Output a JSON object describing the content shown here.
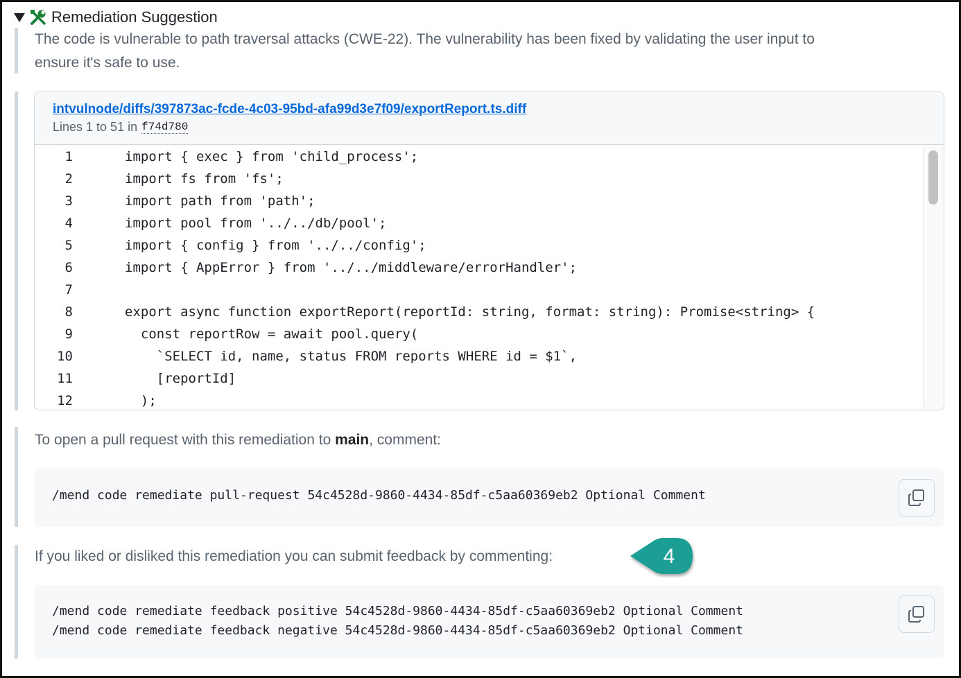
{
  "header": {
    "title": "Remediation Suggestion"
  },
  "description": {
    "line1": "The code is vulnerable to path traversal attacks (CWE-22). The vulnerability has been fixed by validating the user input to",
    "line2": "ensure it's safe to use."
  },
  "diff": {
    "link": "intvulnode/diffs/397873ac-fcde-4c03-95bd-afa99d3e7f09/exportReport.ts.diff",
    "lines_label": "Lines 1 to 51 in",
    "commit": "f74d780",
    "code": [
      {
        "n": "1",
        "text": "import { exec } from 'child_process';"
      },
      {
        "n": "2",
        "text": "import fs from 'fs';"
      },
      {
        "n": "3",
        "text": "import path from 'path';"
      },
      {
        "n": "4",
        "text": "import pool from '../../db/pool';"
      },
      {
        "n": "5",
        "text": "import { config } from '../../config';"
      },
      {
        "n": "6",
        "text": "import { AppError } from '../../middleware/errorHandler';"
      },
      {
        "n": "7",
        "text": ""
      },
      {
        "n": "8",
        "text": "export async function exportReport(reportId: string, format: string): Promise<string> {"
      },
      {
        "n": "9",
        "text": "  const reportRow = await pool.query("
      },
      {
        "n": "10",
        "text": "    `SELECT id, name, status FROM reports WHERE id = $1`,"
      },
      {
        "n": "11",
        "text": "    [reportId]"
      },
      {
        "n": "12",
        "text": "  );"
      }
    ]
  },
  "pull_request": {
    "prefix": "To open a pull request with this remediation to ",
    "branch": "main",
    "suffix": ", comment:",
    "command": "/mend code remediate pull-request 54c4528d-9860-4434-85df-c5aa60369eb2 Optional Comment"
  },
  "feedback": {
    "text": "If you liked or disliked this remediation you can submit feedback by commenting:",
    "command_positive": "/mend code remediate feedback positive 54c4528d-9860-4434-85df-c5aa60369eb2 Optional Comment",
    "command_negative": "/mend code remediate feedback negative 54c4528d-9860-4434-85df-c5aa60369eb2 Optional Comment"
  },
  "callout": {
    "number": "4",
    "color": "#1a9e94"
  },
  "colors": {
    "link": "#0969da",
    "muted": "#59636e",
    "icon_green": "#1a7f37"
  },
  "icons": {
    "section": "tools-icon",
    "copy": "copy-icon"
  }
}
